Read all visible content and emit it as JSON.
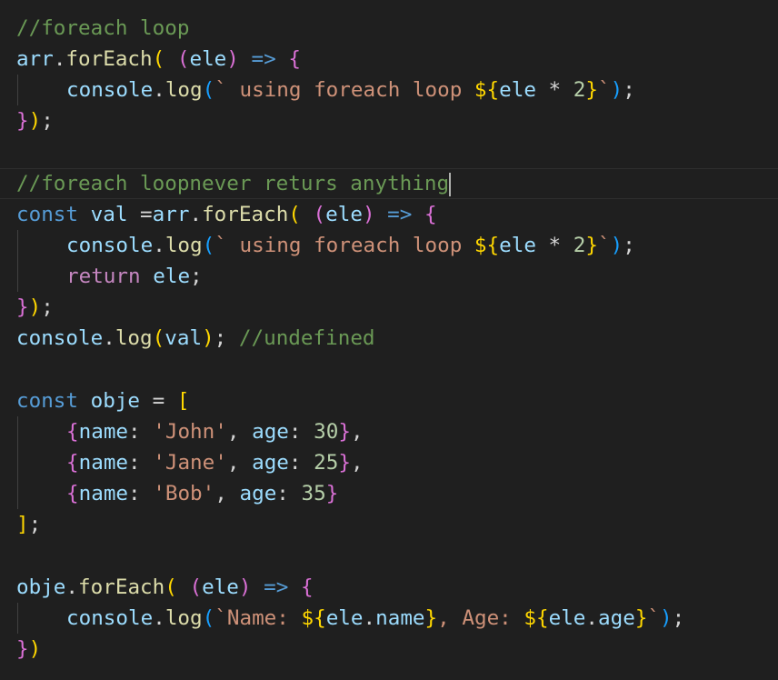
{
  "editor": {
    "comment_1": "//foreach loop",
    "comment_2": "//foreach loopnever returs anything",
    "comment_3": "//undefined",
    "kw_const": "const",
    "kw_return": "return",
    "id_arr": "arr",
    "id_val": "val",
    "id_obje": "obje",
    "id_ele": "ele",
    "id_console": "console",
    "fn_forEach": "forEach",
    "fn_log": "log",
    "prop_name": "name",
    "prop_age": "age",
    "tpl_text_1": " using foreach loop ",
    "tpl_text_name": "Name: ",
    "tpl_text_age": ", Age: ",
    "str_john": "'John'",
    "str_jane": "'Jane'",
    "str_bob": "'Bob'",
    "num_30": "30",
    "num_25": "25",
    "num_35": "35",
    "num_2": "2"
  },
  "colors": {
    "background": "#1f1f1f",
    "comment": "#6a9955",
    "variable": "#9cdcfe",
    "function": "#dcdcaa",
    "keyword": "#569cd6",
    "control_keyword": "#c586c0",
    "string": "#ce9178",
    "number": "#b5cea8",
    "bracket_gold": "#ffd700",
    "bracket_orchid": "#da70d6",
    "bracket_blue": "#179fff"
  }
}
